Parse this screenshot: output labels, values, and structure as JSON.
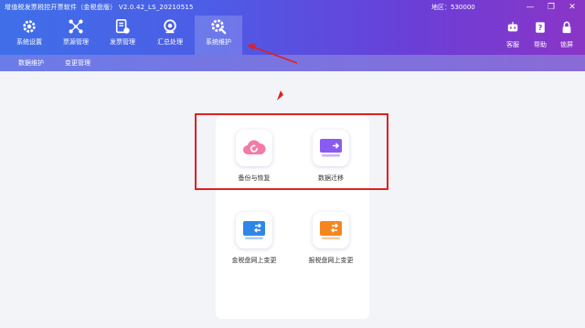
{
  "window": {
    "title": "增值税发票税控开票软件（金税盘版） V2.0.42_LS_20210515",
    "region_label": "地区：530000",
    "controls": [
      "minimize-icon",
      "maximize-icon",
      "close-icon"
    ]
  },
  "toolbar": {
    "items": [
      {
        "label": "系统设置",
        "icon": "gear-icon"
      },
      {
        "label": "票源管理",
        "icon": "network-icon"
      },
      {
        "label": "发票管理",
        "icon": "invoice-icon"
      },
      {
        "label": "汇总处理",
        "icon": "summary-icon"
      },
      {
        "label": "系统维护",
        "icon": "maintenance-icon"
      }
    ],
    "active_index": 4,
    "right_items": [
      {
        "label": "客服",
        "icon": "robot-icon"
      },
      {
        "label": "帮助",
        "icon": "help-icon"
      },
      {
        "label": "锁屏",
        "icon": "lock-icon"
      }
    ]
  },
  "subnav": {
    "items": [
      "数据维护",
      "变更管理"
    ]
  },
  "cards": [
    {
      "label": "备份与恢复",
      "icon": "cloud-restore-icon"
    },
    {
      "label": "数据迁移",
      "icon": "data-migrate-icon"
    },
    {
      "label": "金税盘网上变更",
      "icon": "tax-disk-change-icon"
    },
    {
      "label": "报税盘网上变更",
      "icon": "report-disk-change-icon"
    }
  ],
  "colors": {
    "header_start": "#3f6fe8",
    "header_end": "#8a35c6",
    "annotation": "#e02020"
  }
}
